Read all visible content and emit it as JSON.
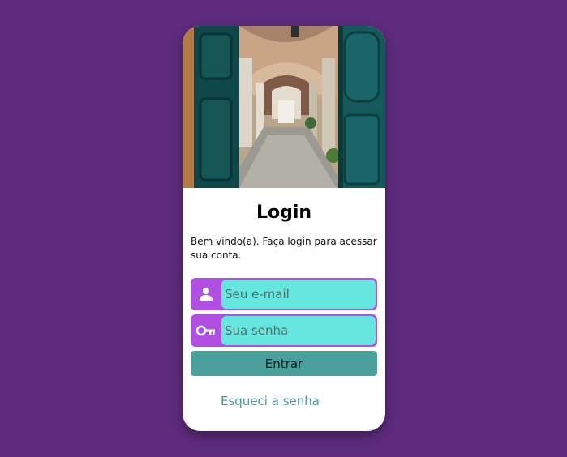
{
  "login": {
    "title": "Login",
    "welcome": "Bem vindo(a). Faça login para acessar sua conta.",
    "email_placeholder": "Seu e-mail",
    "password_placeholder": "Sua senha",
    "submit_label": "Entrar",
    "forgot_label": "Esqueci a senha"
  },
  "icons": {
    "email": "user-icon",
    "password": "key-icon"
  },
  "colors": {
    "background": "#5e2b7d",
    "field_border": "#b14fe3",
    "field_fill": "#65e7e0",
    "button": "#4aa09d",
    "link": "#4b9a99"
  }
}
